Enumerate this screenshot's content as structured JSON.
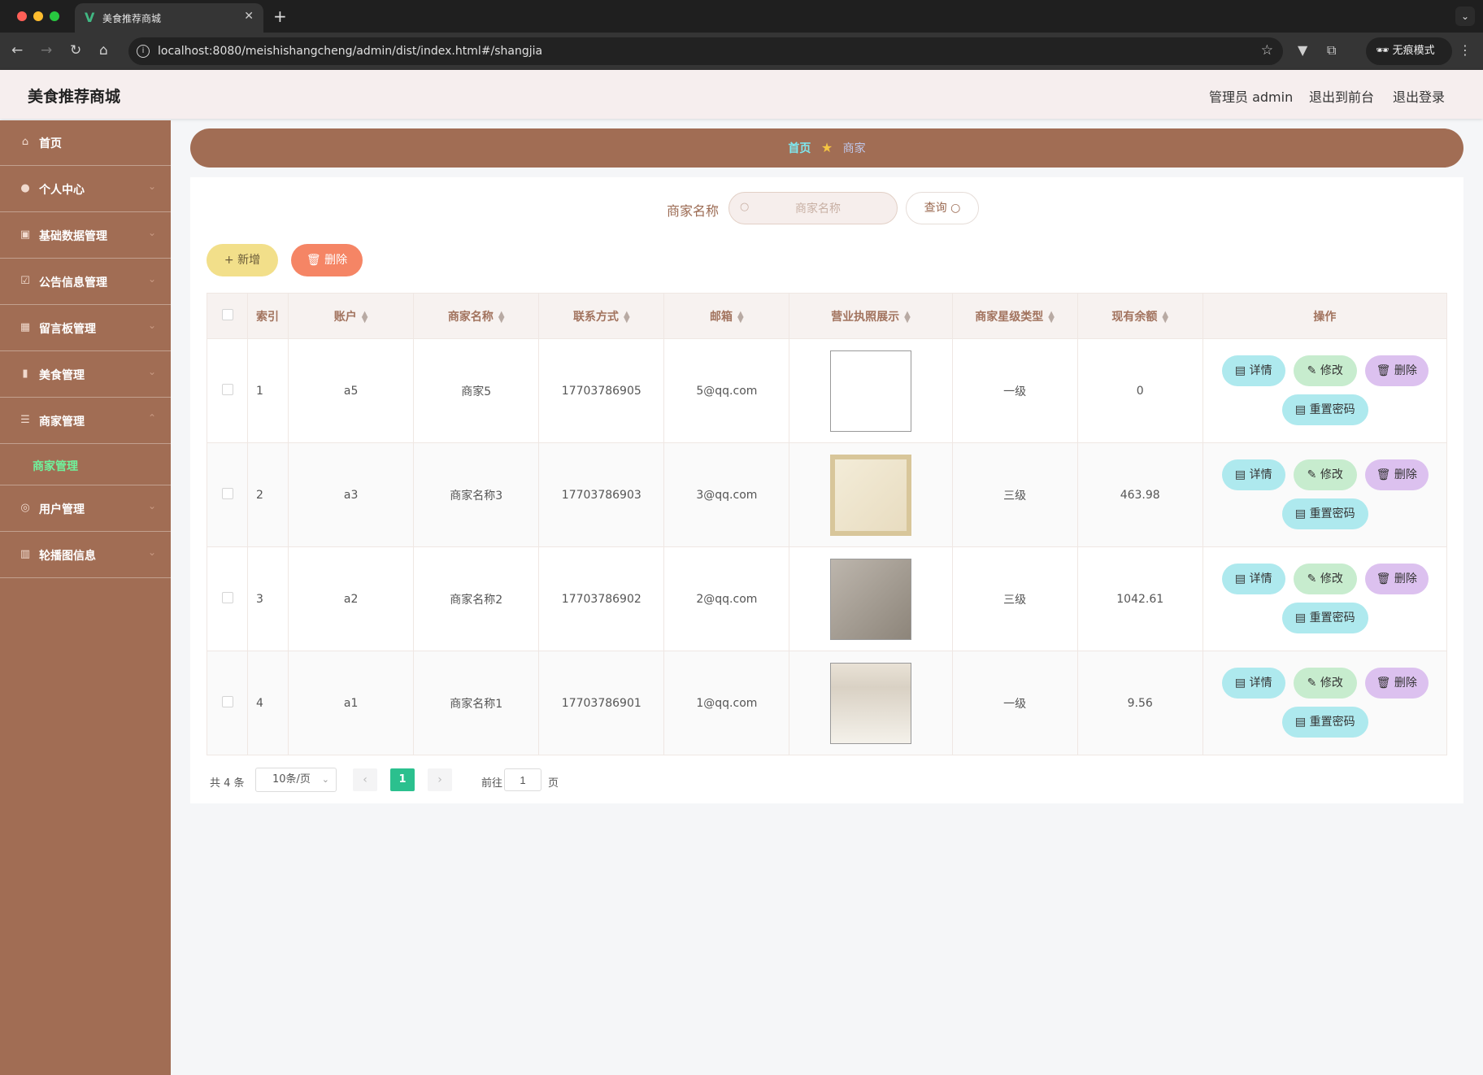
{
  "browser": {
    "tab_title": "美食推荐商城",
    "url": "localhost:8080/meishishangcheng/admin/dist/index.html#/shangjia",
    "incognito_label": "无痕模式"
  },
  "header": {
    "app_title": "美食推荐商城",
    "admin_label": "管理员 admin",
    "frontend_link": "退出到前台",
    "logout_link": "退出登录"
  },
  "sidebar": {
    "items": [
      {
        "label": "首页",
        "icon": "home-icon"
      },
      {
        "label": "个人中心",
        "icon": "user-icon"
      },
      {
        "label": "基础数据管理",
        "icon": "briefcase-icon"
      },
      {
        "label": "公告信息管理",
        "icon": "checkbox-icon"
      },
      {
        "label": "留言板管理",
        "icon": "grid-icon"
      },
      {
        "label": "美食管理",
        "icon": "bar-chart-icon"
      },
      {
        "label": "商家管理",
        "icon": "list-icon"
      },
      {
        "label": "用户管理",
        "icon": "globe-icon"
      },
      {
        "label": "轮播图信息",
        "icon": "chart-icon"
      }
    ],
    "submenu_active": "商家管理"
  },
  "breadcrumb": {
    "home": "首页",
    "current": "商家"
  },
  "search": {
    "label": "商家名称",
    "placeholder": "商家名称",
    "query_label": "查询"
  },
  "actions": {
    "add_label": "新增",
    "delete_label": "删除"
  },
  "table": {
    "headers": [
      "索引",
      "账户",
      "商家名称",
      "联系方式",
      "邮箱",
      "营业执照展示",
      "商家星级类型",
      "现有余额",
      "操作"
    ],
    "rows": [
      {
        "index": "1",
        "account": "a5",
        "name": "商家5",
        "phone": "17703786905",
        "email": "5@qq.com",
        "level": "一级",
        "balance": "0"
      },
      {
        "index": "2",
        "account": "a3",
        "name": "商家名称3",
        "phone": "17703786903",
        "email": "3@qq.com",
        "level": "三级",
        "balance": "463.98"
      },
      {
        "index": "3",
        "account": "a2",
        "name": "商家名称2",
        "phone": "17703786902",
        "email": "2@qq.com",
        "level": "三级",
        "balance": "1042.61"
      },
      {
        "index": "4",
        "account": "a1",
        "name": "商家名称1",
        "phone": "17703786901",
        "email": "1@qq.com",
        "level": "一级",
        "balance": "9.56"
      }
    ],
    "op_labels": {
      "detail": "详情",
      "edit": "修改",
      "delete": "删除",
      "reset": "重置密码"
    }
  },
  "pagination": {
    "total": "共 4 条",
    "page_size": "10条/页",
    "current_page": "1",
    "goto_label": "前往",
    "goto_value": "1",
    "page_suffix": "页"
  }
}
